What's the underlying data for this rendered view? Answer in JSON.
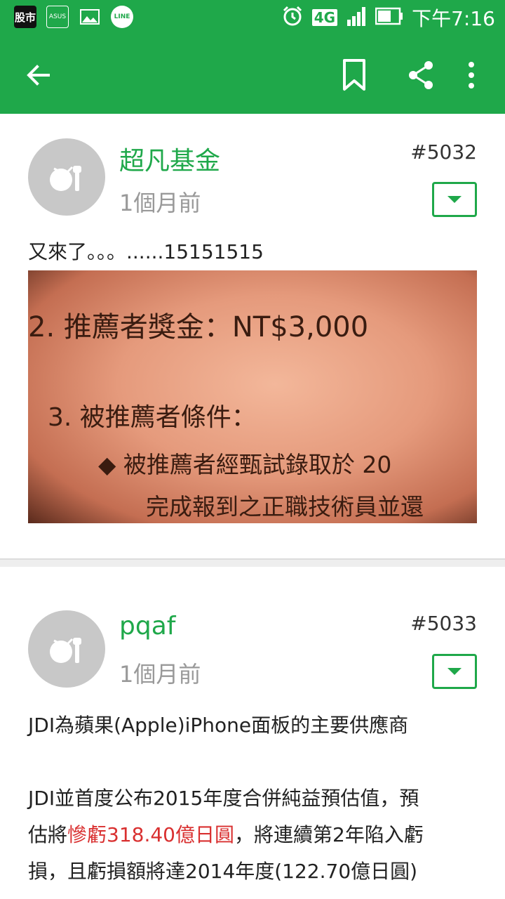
{
  "status_bar": {
    "apps": [
      "股市",
      "ASUS",
      "LINE"
    ],
    "network": "4G",
    "time": "下午7:16"
  },
  "toolbar": {
    "back_icon": "arrow-left-icon",
    "bookmark_icon": "bookmark-icon",
    "share_icon": "share-icon",
    "more_icon": "more-vert-icon"
  },
  "posts": [
    {
      "author": "超凡基金",
      "time": "1個月前",
      "floor": "#5032",
      "text": "又來了。。。......15151515",
      "image": {
        "lines": [
          "2.  推薦者獎金：NT$3,000",
          "3.  被推薦者條件：",
          "◆ 被推薦者經甄試錄取於 20",
          "完成報到之正職技術員並還"
        ]
      }
    },
    {
      "author": "pqaf",
      "time": "1個月前",
      "floor": "#5033",
      "paragraph1": "JDI為蘋果(Apple)iPhone面板的主要供應商",
      "paragraph2_line1": "JDI並首度公布2015年度合併純益預估值，預",
      "paragraph2_line2_pre": "估將",
      "paragraph2_line2_highlight": "慘虧318.40億日圓",
      "paragraph2_line2_post": "，將連續第2年陷入虧",
      "paragraph2_line3": "損，且虧損額將達2014年度(122.70億日圓)"
    }
  ],
  "colors": {
    "brand_green": "#1fa84a",
    "highlight_red": "#d93030"
  }
}
